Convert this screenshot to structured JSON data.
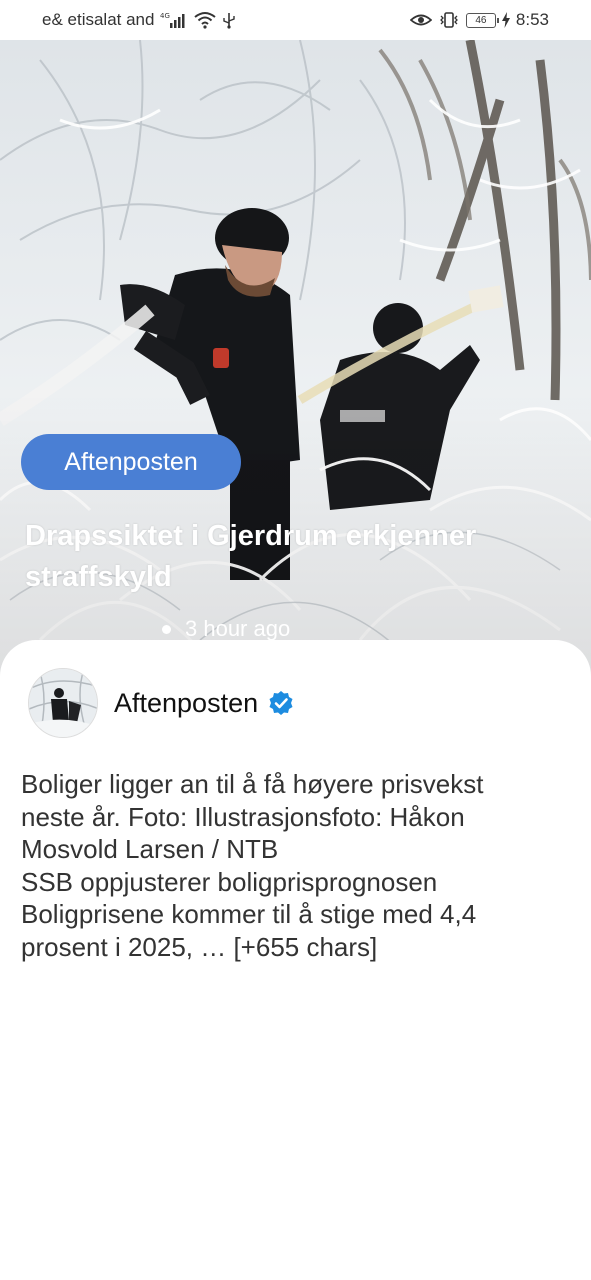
{
  "status_bar": {
    "carrier": "e& etisalat and",
    "network_badge": "4G",
    "battery_level": "46",
    "time": "8:53",
    "icons": [
      "signal-icon",
      "wifi-icon",
      "usb-icon",
      "eye-comfort-icon",
      "vibrate-icon",
      "battery-icon",
      "charging-icon"
    ]
  },
  "hero": {
    "source_label": "Aftenposten",
    "headline": "Drapssiktet i Gjerdrum erkjenner straffskyld",
    "time_ago": "3 hour ago"
  },
  "post": {
    "author": "Aftenposten",
    "verified": true,
    "body_lines": [
      "Boliger ligger an til å få høyere prisvekst",
      "neste år. Foto: Illustrasjonsfoto: Håkon",
      "Mosvold Larsen / NTB",
      "SSB oppjusterer boligprisprognosen",
      "Boligprisene kommer til å stige med 4,4",
      "prosent i 2025, … [+655 chars]"
    ]
  },
  "colors": {
    "accent": "#4a7fd4",
    "verified_badge": "#1d8ce0"
  }
}
